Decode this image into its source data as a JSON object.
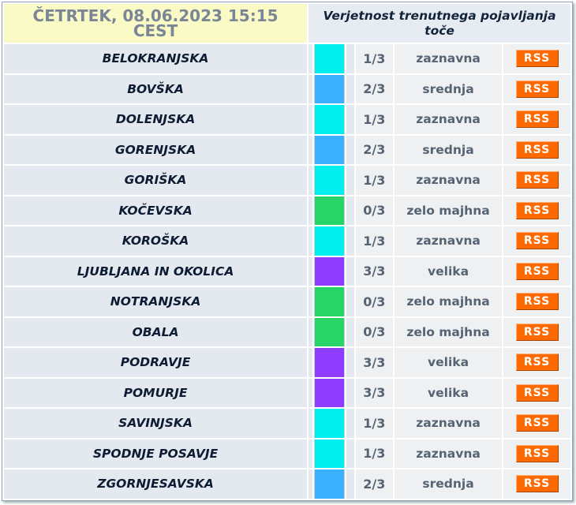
{
  "header": {
    "date_line1": "ČETRTEK, 08.06.2023 15:15",
    "date_line2": "CEST",
    "title_line1": "Verjetnost trenutnega pojavljanja",
    "title_line2": "toče"
  },
  "rss_label": "RSS",
  "colors": {
    "zaznavna": "#00eeee",
    "srednja": "#3ab0ff",
    "zelo majhna": "#27d567",
    "velika": "#8f3cff"
  },
  "rows": [
    {
      "region": "BELOKRANJSKA",
      "level": "1/3",
      "description": "zaznavna",
      "color": "#00eeee"
    },
    {
      "region": "BOVŠKA",
      "level": "2/3",
      "description": "srednja",
      "color": "#3ab0ff"
    },
    {
      "region": "DOLENJSKA",
      "level": "1/3",
      "description": "zaznavna",
      "color": "#00eeee"
    },
    {
      "region": "GORENJSKA",
      "level": "2/3",
      "description": "srednja",
      "color": "#3ab0ff"
    },
    {
      "region": "GORIŠKA",
      "level": "1/3",
      "description": "zaznavna",
      "color": "#00eeee"
    },
    {
      "region": "KOČEVSKA",
      "level": "0/3",
      "description": "zelo majhna",
      "color": "#27d567"
    },
    {
      "region": "KOROŠKA",
      "level": "1/3",
      "description": "zaznavna",
      "color": "#00eeee"
    },
    {
      "region": "LJUBLJANA IN OKOLICA",
      "level": "3/3",
      "description": "velika",
      "color": "#8f3cff"
    },
    {
      "region": "NOTRANJSKA",
      "level": "0/3",
      "description": "zelo majhna",
      "color": "#27d567"
    },
    {
      "region": "OBALA",
      "level": "0/3",
      "description": "zelo majhna",
      "color": "#27d567"
    },
    {
      "region": "PODRAVJE",
      "level": "3/3",
      "description": "velika",
      "color": "#8f3cff"
    },
    {
      "region": "POMURJE",
      "level": "3/3",
      "description": "velika",
      "color": "#8f3cff"
    },
    {
      "region": "SAVINJSKA",
      "level": "1/3",
      "description": "zaznavna",
      "color": "#00eeee"
    },
    {
      "region": "SPODNJE POSAVJE",
      "level": "1/3",
      "description": "zaznavna",
      "color": "#00eeee"
    },
    {
      "region": "ZGORNJESAVSKA",
      "level": "2/3",
      "description": "srednja",
      "color": "#3ab0ff"
    }
  ]
}
